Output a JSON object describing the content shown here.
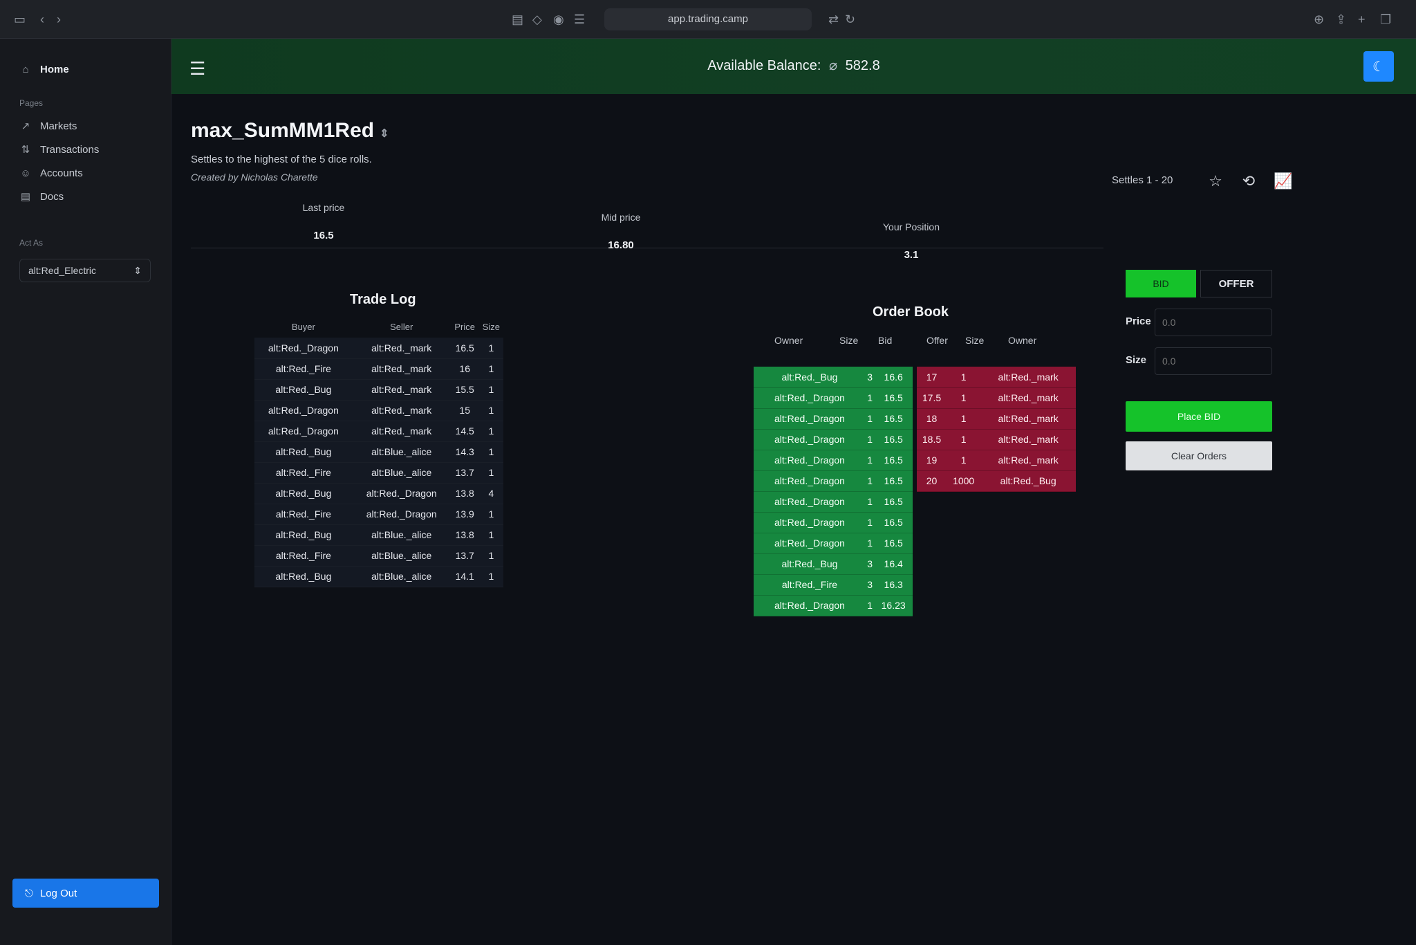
{
  "browser": {
    "url": "app.trading.camp"
  },
  "sidebar": {
    "home": "Home",
    "pages_caption": "Pages",
    "items": [
      {
        "label": "Markets",
        "icon": "trend-icon"
      },
      {
        "label": "Transactions",
        "icon": "transfer-icon"
      },
      {
        "label": "Accounts",
        "icon": "person-icon"
      },
      {
        "label": "Docs",
        "icon": "docs-icon"
      }
    ],
    "act_as_caption": "Act As",
    "act_as_value": "alt:Red_Electric",
    "logout_label": "Log Out"
  },
  "header": {
    "balance_label": "Available Balance:",
    "balance_value": "582.8"
  },
  "market": {
    "title": "max_SumMM1Red",
    "description": "Settles to the highest of the 5 dice rolls.",
    "author": "Created by Nicholas Charette",
    "settles": "Settles 1 - 20"
  },
  "stats": {
    "last_price_label": "Last price",
    "last_price": "16.5",
    "mid_price_label": "Mid price",
    "mid_price": "16.80",
    "position_label": "Your Position",
    "position": "3.1"
  },
  "trade_log": {
    "title": "Trade Log",
    "columns": [
      "Buyer",
      "Seller",
      "Price",
      "Size"
    ],
    "rows": [
      [
        "alt:Red._Dragon",
        "alt:Red._mark",
        "16.5",
        "1"
      ],
      [
        "alt:Red._Fire",
        "alt:Red._mark",
        "16",
        "1"
      ],
      [
        "alt:Red._Bug",
        "alt:Red._mark",
        "15.5",
        "1"
      ],
      [
        "alt:Red._Dragon",
        "alt:Red._mark",
        "15",
        "1"
      ],
      [
        "alt:Red._Dragon",
        "alt:Red._mark",
        "14.5",
        "1"
      ],
      [
        "alt:Red._Bug",
        "alt:Blue._alice",
        "14.3",
        "1"
      ],
      [
        "alt:Red._Fire",
        "alt:Blue._alice",
        "13.7",
        "1"
      ],
      [
        "alt:Red._Bug",
        "alt:Red._Dragon",
        "13.8",
        "4"
      ],
      [
        "alt:Red._Fire",
        "alt:Red._Dragon",
        "13.9",
        "1"
      ],
      [
        "alt:Red._Bug",
        "alt:Blue._alice",
        "13.8",
        "1"
      ],
      [
        "alt:Red._Fire",
        "alt:Blue._alice",
        "13.7",
        "1"
      ],
      [
        "alt:Red._Bug",
        "alt:Blue._alice",
        "14.1",
        "1"
      ]
    ]
  },
  "order_book": {
    "title": "Order Book",
    "bid_columns": [
      "Owner",
      "Size",
      "Bid"
    ],
    "offer_columns": [
      "Offer",
      "Size",
      "Owner"
    ],
    "bids": [
      [
        "alt:Red._Bug",
        "3",
        "16.6"
      ],
      [
        "alt:Red._Dragon",
        "1",
        "16.5"
      ],
      [
        "alt:Red._Dragon",
        "1",
        "16.5"
      ],
      [
        "alt:Red._Dragon",
        "1",
        "16.5"
      ],
      [
        "alt:Red._Dragon",
        "1",
        "16.5"
      ],
      [
        "alt:Red._Dragon",
        "1",
        "16.5"
      ],
      [
        "alt:Red._Dragon",
        "1",
        "16.5"
      ],
      [
        "alt:Red._Dragon",
        "1",
        "16.5"
      ],
      [
        "alt:Red._Dragon",
        "1",
        "16.5"
      ],
      [
        "alt:Red._Bug",
        "3",
        "16.4"
      ],
      [
        "alt:Red._Fire",
        "3",
        "16.3"
      ],
      [
        "alt:Red._Dragon",
        "1",
        "16.23"
      ]
    ],
    "offers": [
      [
        "17",
        "1",
        "alt:Red._mark"
      ],
      [
        "17.5",
        "1",
        "alt:Red._mark"
      ],
      [
        "18",
        "1",
        "alt:Red._mark"
      ],
      [
        "18.5",
        "1",
        "alt:Red._mark"
      ],
      [
        "19",
        "1",
        "alt:Red._mark"
      ],
      [
        "20",
        "1000",
        "alt:Red._Bug"
      ]
    ]
  },
  "order_entry": {
    "bid_label": "BID",
    "offer_label": "OFFER",
    "price_label": "Price",
    "price_value": "0.0",
    "size_label": "Size",
    "size_value": "0.0",
    "place_label": "Place BID",
    "clear_label": "Clear Orders"
  },
  "colors": {
    "header_green": "#123f24",
    "bid_green": "#16883f",
    "offer_red": "#8a1432",
    "accent_blue": "#1e88ff",
    "bright_green": "#15c22a"
  }
}
